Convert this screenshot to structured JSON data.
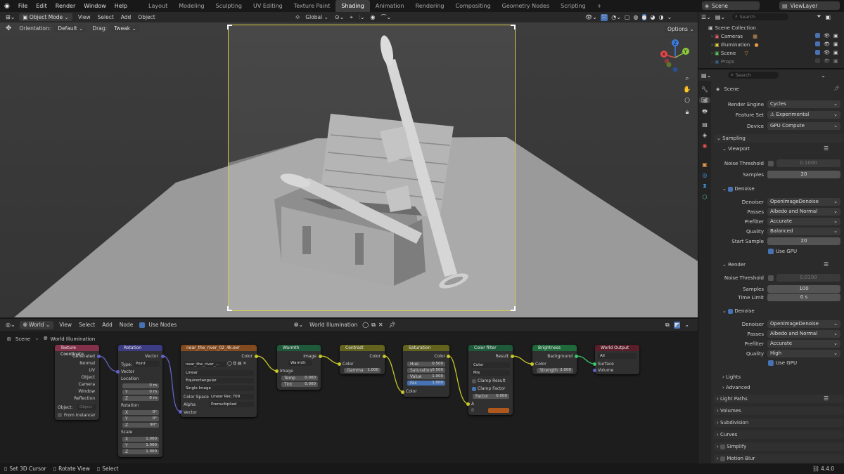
{
  "topbar": {
    "menus": [
      "File",
      "Edit",
      "Render",
      "Window",
      "Help"
    ],
    "workspaces": [
      "Layout",
      "Modeling",
      "Sculpting",
      "UV Editing",
      "Texture Paint",
      "Shading",
      "Animation",
      "Rendering",
      "Compositing",
      "Geometry Nodes",
      "Scripting"
    ],
    "active_workspace": "Shading",
    "add_tab": "+",
    "scene": "Scene",
    "view_layer": "ViewLayer"
  },
  "viewport_header": {
    "mode": "Object Mode",
    "menus": [
      "View",
      "Select",
      "Add",
      "Object"
    ],
    "transform_orientation": "Global",
    "orientation_label": "Orientation:",
    "orientation_value": "Default",
    "drag_label": "Drag:",
    "drag_value": "Tweak",
    "options": "Options"
  },
  "gizmo": {
    "x": "X",
    "y": "Y",
    "z": "Z"
  },
  "node_header": {
    "world_label": "World",
    "menus": [
      "View",
      "Select",
      "Add",
      "Node"
    ],
    "use_nodes": "Use Nodes",
    "datablock": "World Illumination"
  },
  "breadcrumb": {
    "scene": "Scene",
    "world": "World Illumination"
  },
  "nodes": {
    "texcoord": {
      "title": "Texture Coordinate",
      "outputs": [
        "Generated",
        "Normal",
        "UV",
        "Object",
        "Camera",
        "Window",
        "Reflection"
      ],
      "object_label": "Object:",
      "object_placeholder": "Object",
      "from_instancer": "From Instancer"
    },
    "mapping": {
      "title": "Rotation",
      "out": "Vector",
      "type_label": "Type:",
      "type_value": "Point",
      "vector": "Vector",
      "location": "Location",
      "loc": [
        [
          "X",
          "0 m"
        ],
        [
          "Y",
          "0 m"
        ],
        [
          "Z",
          "0 m"
        ]
      ],
      "rotation": "Rotation",
      "rot": [
        [
          "X",
          "0°"
        ],
        [
          "Y",
          "0°"
        ],
        [
          "Z",
          "90°"
        ]
      ],
      "scale": "Scale",
      "scl": [
        [
          "X",
          "1.000"
        ],
        [
          "Y",
          "1.000"
        ],
        [
          "Z",
          "1.000"
        ]
      ]
    },
    "envtex": {
      "title": "near_the_river_02_4k.exr",
      "out": "Color",
      "file": "near_the_river_...",
      "interp": "Linear",
      "proj": "Equirectangular",
      "source": "Single Image",
      "colorspace_label": "Color Space",
      "colorspace": "Linear Rec.709",
      "alpha_label": "Alpha",
      "alpha": "Premultiplied",
      "vector": "Vector"
    },
    "warmth": {
      "title": "Warmth",
      "out": "Image",
      "group": "Warmth",
      "image": "Image",
      "temp_label": "Temp",
      "temp": "0.000",
      "tint_label": "Tint",
      "tint": "0.000"
    },
    "contrast": {
      "title": "Contrast",
      "out": "Color",
      "color": "Color",
      "gamma_label": "Gamma",
      "gamma": "1.000"
    },
    "saturation": {
      "title": "Saturation",
      "out": "Color",
      "hue_label": "Hue",
      "hue": "0.500",
      "sat_label": "Saturation",
      "sat": "0.500",
      "val_label": "Value",
      "val": "1.000",
      "fac_label": "Fac",
      "fac": "1.000",
      "color": "Color"
    },
    "colorfilter": {
      "title": "Color filter",
      "out": "Result",
      "type": "Color",
      "blend": "Mix",
      "clamp_result": "Clamp Result",
      "clamp_factor": "Clamp Factor",
      "factor_label": "Factor",
      "factor": "0.000",
      "a": "A",
      "b": "B",
      "swatch": "#b0581c"
    },
    "brightness": {
      "title": "Brightness",
      "out": "Background",
      "color": "Color",
      "strength_label": "Strength",
      "strength": "2.000"
    },
    "output": {
      "title": "World Output",
      "target": "All",
      "surface": "Surface",
      "volume": "Volume"
    }
  },
  "status": {
    "select_cursor": "Set 3D Cursor",
    "rotate": "Rotate View",
    "select": "Select",
    "version": "4.4.0"
  },
  "outliner": {
    "search_placeholder": "Search",
    "collection": "Scene Collection",
    "items": [
      {
        "label": "Cameras",
        "color": "#e0616c"
      },
      {
        "label": "Illumination",
        "color": "#e8d140"
      },
      {
        "label": "Scene",
        "color": "#5ac85a"
      },
      {
        "label": "Props",
        "color": "#4a9ae0"
      }
    ]
  },
  "properties": {
    "search_placeholder": "Search",
    "scene": "Scene",
    "render_engine_label": "Render Engine",
    "render_engine": "Cycles",
    "feature_set_label": "Feature Set",
    "feature_set": "Experimental",
    "device_label": "Device",
    "device": "GPU Compute",
    "sampling": "Sampling",
    "viewport": "Viewport",
    "noise_threshold_label": "Noise Threshold",
    "vp_noise": "0.1000",
    "samples_label": "Samples",
    "vp_samples": "20",
    "denoise": "Denoise",
    "denoiser_label": "Denoiser",
    "denoiser": "OpenImageDenoise",
    "passes_label": "Passes",
    "passes": "Albedo and Normal",
    "prefilter_label": "Prefilter",
    "prefilter": "Accurate",
    "quality_label": "Quality",
    "vp_quality": "Balanced",
    "start_sample_label": "Start Sample",
    "start_sample": "20",
    "use_gpu": "Use GPU",
    "render": "Render",
    "r_noise": "0.0100",
    "r_samples": "100",
    "time_limit_label": "Time Limit",
    "time_limit": "0 s",
    "r_quality": "High",
    "lights": "Lights",
    "advanced": "Advanced",
    "light_paths": "Light Paths",
    "volumes": "Volumes",
    "subdivision": "Subdivision",
    "curves": "Curves",
    "simplify": "Simplify",
    "motion_blur": "Motion Blur"
  }
}
